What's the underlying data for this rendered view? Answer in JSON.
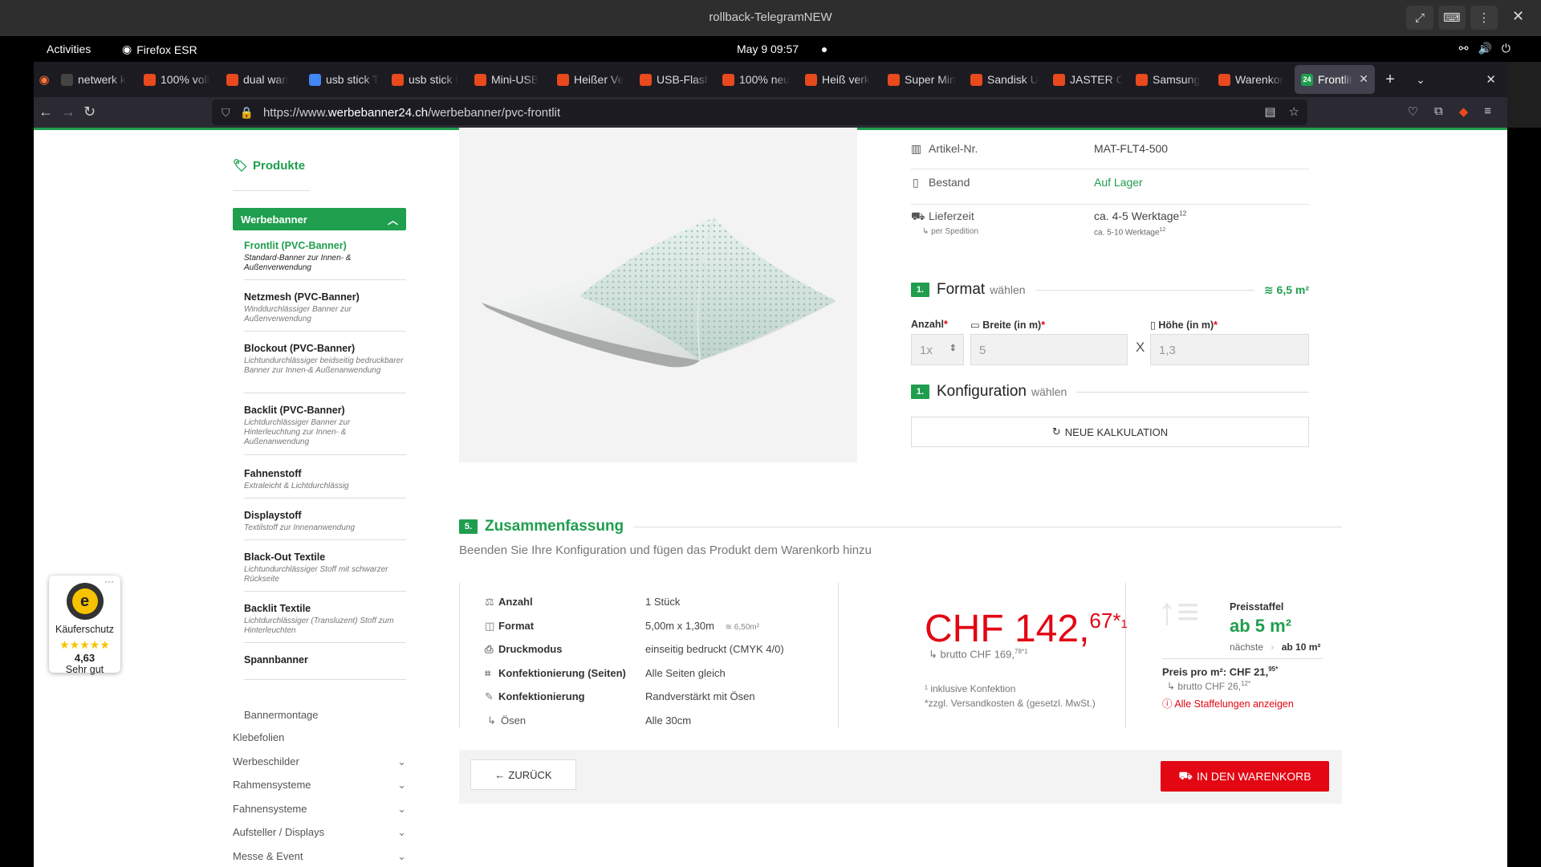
{
  "window": {
    "title": "rollback-TelegramNEW"
  },
  "gnome": {
    "activities": "Activities",
    "app": "Firefox ESR",
    "clock": "May 9  09:57"
  },
  "tabs": [
    {
      "label": "netwerk k",
      "color": "#444"
    },
    {
      "label": "100% voll",
      "color": "#e8491d"
    },
    {
      "label": "dual wan",
      "color": "#e8491d"
    },
    {
      "label": "usb stick T",
      "color": "#4285f4"
    },
    {
      "label": "usb stick t",
      "color": "#e8491d"
    },
    {
      "label": "Mini-USB",
      "color": "#e8491d"
    },
    {
      "label": "Heißer Ve",
      "color": "#e8491d"
    },
    {
      "label": "USB-Flash",
      "color": "#e8491d"
    },
    {
      "label": "100% neu",
      "color": "#e8491d"
    },
    {
      "label": "Heiß verk",
      "color": "#e8491d"
    },
    {
      "label": "Super Min",
      "color": "#e8491d"
    },
    {
      "label": "Sandisk U",
      "color": "#e8491d"
    },
    {
      "label": "JASTER C",
      "color": "#e8491d"
    },
    {
      "label": "Samsung",
      "color": "#e8491d"
    },
    {
      "label": "Warenkor",
      "color": "#e8491d"
    }
  ],
  "active_tab": {
    "label": "Frontlit",
    "badge": "24"
  },
  "url": {
    "prefix": "https://www.",
    "domain": "werbebanner24.ch",
    "path": "/werbebanner/pvc-frontlit"
  },
  "sidebar": {
    "produkte": "Produkte",
    "werbebanner": "Werbebanner",
    "subitems": [
      {
        "title": "Frontlit (PVC-Banner)",
        "desc": "Standard-Banner zur Innen- & Außenverwendung"
      },
      {
        "title": "Netzmesh (PVC-Banner)",
        "desc": "Winddurchlässiger Banner zur Außenverwendung"
      },
      {
        "title": "Blockout (PVC-Banner)",
        "desc": "Lichtundurchlässiger beidseitig bedruckbarer Banner zur Innen-& Außenanwendung"
      },
      {
        "title": "Backlit (PVC-Banner)",
        "desc": "Lichtdurchlässiger Banner zur Hinterleuchtung zur Innen- & Außenanwendung"
      },
      {
        "title": "Fahnenstoff",
        "desc": "Extraleicht & Lichtdurchlässig"
      },
      {
        "title": "Displaystoff",
        "desc": "Textilstoff zur Innenanwendung"
      },
      {
        "title": "Black-Out Textile",
        "desc": "Lichtundurchlässiger Stoff mit schwarzer Rückseite"
      },
      {
        "title": "Backlit Textile",
        "desc": "Lichtdurchlässiger (Transluzent) Stoff zum Hinterleuchten"
      },
      {
        "title": "Spannbanner",
        "desc": ""
      }
    ],
    "bannermontage": "Bannermontage",
    "categories": [
      "Klebefolien",
      "Werbeschilder",
      "Rahmensysteme",
      "Fahnensysteme",
      "Aufsteller / Displays",
      "Messe & Event"
    ]
  },
  "info": {
    "artikel_label": "Artikel-Nr.",
    "artikel_value": "MAT-FLT4-500",
    "bestand_label": "Bestand",
    "bestand_value": "Auf Lager",
    "lieferzeit_label": "Lieferzeit",
    "lieferzeit_sub": "per Spedition",
    "lieferzeit_value": "ca. 4-5 Werktage",
    "lieferzeit_value_sup": "12",
    "lieferzeit_value2": "ca. 5-10 Werktage",
    "lieferzeit_value2_sup": "12"
  },
  "format": {
    "num": "1.",
    "title": "Format",
    "suffix": "wählen",
    "area": "6,5 m²",
    "anzahl_label": "Anzahl",
    "anzahl_value": "1x",
    "breite_label": "Breite (in m)",
    "breite_value": "5",
    "hoehe_label": "Höhe (in m)",
    "hoehe_value": "1,3",
    "times": "X"
  },
  "konfig": {
    "num": "1.",
    "title": "Konfiguration",
    "suffix": "wählen",
    "button": "NEUE KALKULATION"
  },
  "summary": {
    "num": "5.",
    "title": "Zusammenfassung",
    "desc": "Beenden Sie Ihre Konfiguration und fügen das Produkt dem Warenkorb hinzu",
    "rows": [
      {
        "k": "Anzahl",
        "v": "1 Stück",
        "extra": ""
      },
      {
        "k": "Format",
        "v": "5,00m x 1,30m",
        "extra": "6,50m²"
      },
      {
        "k": "Druckmodus",
        "v": "einseitig bedruckt (CMYK 4/0)",
        "extra": ""
      },
      {
        "k": "Konfektionierung (Seiten)",
        "v": "Alle Seiten gleich",
        "extra": ""
      },
      {
        "k": "Konfektionierung",
        "v": "Randverstärkt mit Ösen",
        "extra": ""
      },
      {
        "k": "Ösen",
        "v": "Alle 30cm",
        "extra": ""
      }
    ],
    "price_main": "CHF 142,",
    "price_cents": "67",
    "price_star": "*",
    "price_sup": "1",
    "brutto": "brutto CHF 169,",
    "brutto_sup": "78*1",
    "note1": "¹ inklusive Konfektion",
    "note2": "*zzgl. Versandkosten & (gesetzl. MwSt.)",
    "staffel_label": "Preisstaffel",
    "staffel_value": "ab 5 m²",
    "naechste_label": "nächste",
    "naechste_value": "ab 10 m²",
    "ppm_label": "Preis pro m²: CHF 21,",
    "ppm_sup": "95*",
    "ppm_brutto": "brutto CHF 26,",
    "ppm_brutto_sup": "12*",
    "alle": "Alle Staffelungen anzeigen"
  },
  "actions": {
    "back": "ZURÜCK",
    "cart": "IN DEN WARENKORB"
  },
  "trust": {
    "label": "Käuferschutz",
    "score": "4,63",
    "rating": "Sehr gut",
    "stars": "★★★★★"
  }
}
